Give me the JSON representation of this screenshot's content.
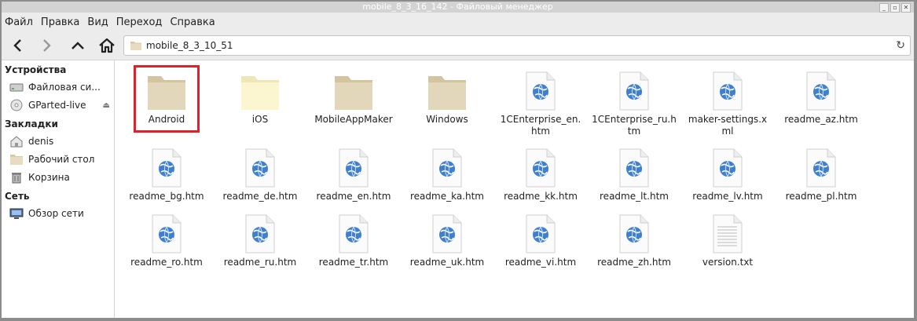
{
  "window": {
    "title": "mobile_8_3_16_142 - Файловый менеджер",
    "buttons": [
      "_",
      "▫",
      "✕"
    ]
  },
  "menubar": {
    "items": [
      "Файл",
      "Правка",
      "Вид",
      "Переход",
      "Справка"
    ]
  },
  "toolbar": {
    "back_glyph": "❮",
    "forward_glyph": "❯",
    "up_glyph": "⌃",
    "path": "mobile_8_3_10_51",
    "reload_glyph": "↻"
  },
  "sidebar": {
    "sections": [
      {
        "title": "Устройства",
        "items": [
          {
            "label": "Файловая си...",
            "icon": "drive-icon"
          },
          {
            "label": "GParted-live",
            "icon": "disc-icon",
            "eject": "⏏"
          }
        ]
      },
      {
        "title": "Закладки",
        "items": [
          {
            "label": "denis",
            "icon": "home-icon"
          },
          {
            "label": "Рабочий стол",
            "icon": "desktop-icon"
          },
          {
            "label": "Корзина",
            "icon": "trash-icon"
          }
        ]
      },
      {
        "title": "Сеть",
        "items": [
          {
            "label": "Обзор сети",
            "icon": "network-icon"
          }
        ]
      }
    ]
  },
  "files": [
    {
      "name": "Android",
      "type": "folder",
      "selected": true
    },
    {
      "name": "iOS",
      "type": "folder-light"
    },
    {
      "name": "MobileAppMaker",
      "type": "folder"
    },
    {
      "name": "Windows",
      "type": "folder"
    },
    {
      "name": "1CEnterprise_en.htm",
      "type": "htm"
    },
    {
      "name": "1CEnterprise_ru.htm",
      "type": "htm"
    },
    {
      "name": "maker-settings.xml",
      "type": "htm"
    },
    {
      "name": "readme_az.htm",
      "type": "htm"
    },
    {
      "name": "readme_bg.htm",
      "type": "htm"
    },
    {
      "name": "readme_de.htm",
      "type": "htm"
    },
    {
      "name": "readme_en.htm",
      "type": "htm"
    },
    {
      "name": "readme_ka.htm",
      "type": "htm"
    },
    {
      "name": "readme_kk.htm",
      "type": "htm"
    },
    {
      "name": "readme_lt.htm",
      "type": "htm"
    },
    {
      "name": "readme_lv.htm",
      "type": "htm"
    },
    {
      "name": "readme_pl.htm",
      "type": "htm"
    },
    {
      "name": "readme_ro.htm",
      "type": "htm"
    },
    {
      "name": "readme_ru.htm",
      "type": "htm"
    },
    {
      "name": "readme_tr.htm",
      "type": "htm"
    },
    {
      "name": "readme_uk.htm",
      "type": "htm"
    },
    {
      "name": "readme_vi.htm",
      "type": "htm"
    },
    {
      "name": "readme_zh.htm",
      "type": "htm"
    },
    {
      "name": "version.txt",
      "type": "txt"
    }
  ],
  "colors": {
    "highlight": "#e0202a",
    "folder": "#e3d7bb",
    "folder_light": "#fbf5d0",
    "globe": "#3f7fd0"
  }
}
